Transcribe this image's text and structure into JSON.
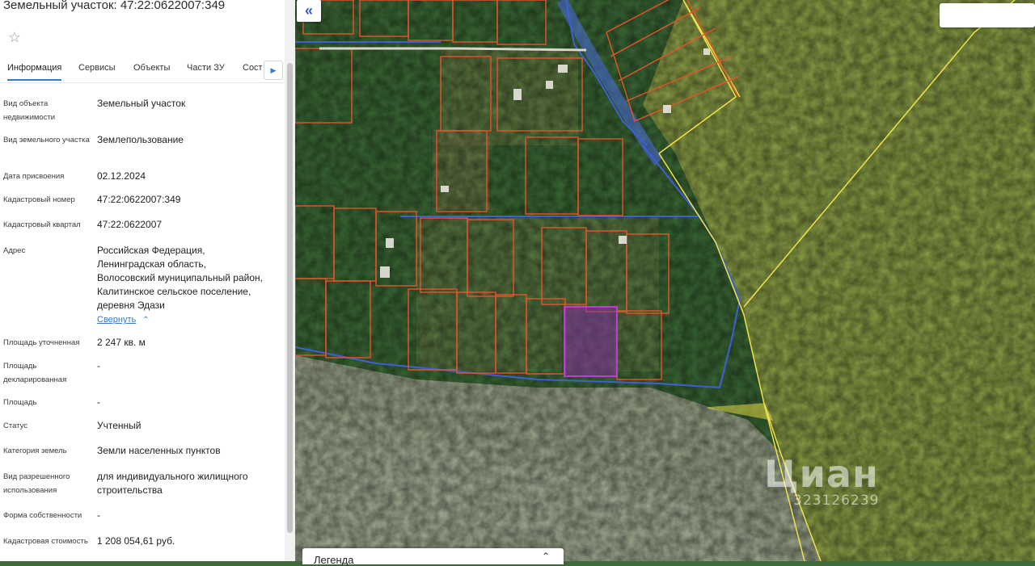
{
  "panel": {
    "title": "Земельный участок: 47:22:0622007:349",
    "favorite_icon": "star-outline-icon",
    "tabs": [
      {
        "label": "Информация",
        "active": true
      },
      {
        "label": "Сервисы"
      },
      {
        "label": "Объекты"
      },
      {
        "label": "Части ЗУ"
      },
      {
        "label": "Состав"
      }
    ],
    "tabs_next_icon": "triangle-right-icon",
    "fields": {
      "object_type": {
        "label": "Вид объекта недвижимости",
        "value": "Земельный участок"
      },
      "land_type": {
        "label": "Вид земельного участка",
        "value": "Землепользование"
      },
      "date": {
        "label": "Дата присвоения",
        "value": "02.12.2024"
      },
      "cadastral_number": {
        "label": "Кадастровый номер",
        "value": "47:22:0622007:349"
      },
      "cadastral_quarter": {
        "label": "Кадастровый квартал",
        "value": "47:22:0622007"
      },
      "address": {
        "label": "Адрес",
        "lines": [
          "Российская Федерация,",
          "Ленинградская область,",
          "Волосовский муниципальный район,",
          "Калитинское сельское поселение,",
          "деревня Эдази"
        ],
        "collapse_label": "Свернуть"
      },
      "area_specified": {
        "label": "Площадь уточненная",
        "value": "2 247 кв. м"
      },
      "area_declared": {
        "label": "Площадь декларированная",
        "value": "-"
      },
      "area": {
        "label": "Площадь",
        "value": "-"
      },
      "status": {
        "label": "Статус",
        "value": "Учтенный"
      },
      "land_category": {
        "label": "Категория земель",
        "value": "Земли населенных пунктов"
      },
      "permitted_use": {
        "label": "Вид разрешенного использования",
        "value": "для индивидуального жилищного строительства"
      },
      "ownership": {
        "label": "Форма собственности",
        "value": "-"
      },
      "cadastral_value": {
        "label": "Кадастровая стоимость",
        "value": "1 208 054,61 руб."
      }
    }
  },
  "map": {
    "collapse_icon": "double-chevron-left-icon",
    "legend_label": "Легенда",
    "legend_icon": "chevron-up-icon",
    "watermark": {
      "logo": "Циан",
      "id": "323126239"
    },
    "colors": {
      "parcel_border": "#e8532a",
      "selected_parcel": "#c13ad6",
      "quarter_border": "#3e5fd6",
      "forest_zone": "#f2e24a"
    }
  }
}
